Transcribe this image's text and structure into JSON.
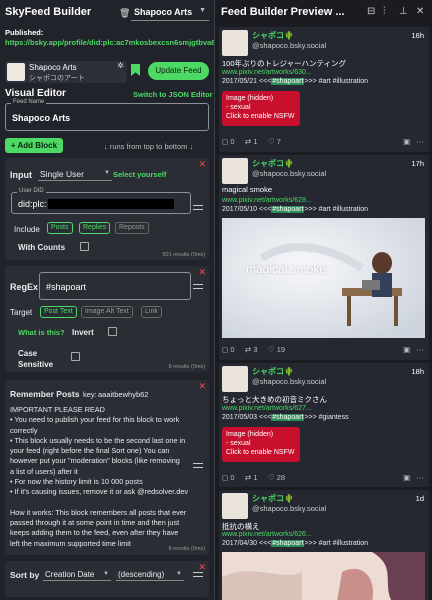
{
  "app": {
    "title": "SkyFeed Builder",
    "feed_select": "Shapoco Arts",
    "published_label": "Published:",
    "published_url": "https://bsky.app/profile/did:plc:ac7mkosbexcsn6smjgtbva6o/feed/aaaitbewhyb62"
  },
  "account": {
    "name": "Shapoco Arts",
    "subtitle": "シャポコのアート"
  },
  "buttons": {
    "update": "Update Feed",
    "switch_json": "Switch to JSON Editor",
    "add_block": "+ Add Block"
  },
  "visual_editor": {
    "title": "Visual Editor",
    "feed_name_label": "Feed Name",
    "feed_name": "Shapoco Arts",
    "runs_note": "↓ runs from top to bottom ↓"
  },
  "input_block": {
    "label": "Input",
    "type": "Single User",
    "select_yourself": "Select yourself",
    "user_did_label": "User DID",
    "user_did": "did:plc:",
    "include_label": "Include",
    "chips": [
      "Posts",
      "Replies",
      "Reposts"
    ],
    "with_counts": "With Counts",
    "results": "501 results (0ms)"
  },
  "regex_block": {
    "label": "RegEx",
    "value": "#shapoart",
    "target_label": "Target",
    "chips": [
      "Post Text",
      "Image Alt Text",
      "Link"
    ],
    "what_is_this": "What is this?",
    "invert": "Invert",
    "case_sensitive": "Case Sensitive",
    "results": "8 results (0ms)"
  },
  "remember_block": {
    "label": "Remember Posts",
    "key_label": "key:",
    "key": "aaaitbewhyb62",
    "lines": [
      "IMPORTANT PLEASE READ",
      "• You need to publish your feed for this block to work",
      "correctly",
      "• This block usually needs to be the second last one in",
      "your feed (right before the final Sort one) You can",
      "however put your \"moderation\" blocks (like removing",
      "a list of users) after it",
      "• For now the history limit is 10 000 posts",
      "• If it's causing issues, remove it or ask @redsolver.dev",
      "",
      "How it works: This block remembers all posts that ever",
      "passed through it at some point in time and then just",
      "keeps adding them to the feed, even after they have",
      "left the maximum supported time limit"
    ],
    "results": "8 results (0ms)"
  },
  "sort_block": {
    "label": "Sort by",
    "field": "Creation Date",
    "order": "(descending)"
  },
  "preview": {
    "title": "Feed Builder Preview ...",
    "posts": [
      {
        "name": "シャポコ🌵",
        "handle": "@shapoco.bsky.social",
        "time": "16h",
        "text": "100年ぶりのトレジャーハンティング",
        "date": "2017/05/21 <<<",
        "tag": "#shapoart",
        "rest": ">>> #art #illustration",
        "url": "www.pixiv.net/artworks/630...",
        "hidden": [
          "Image (hidden)",
          "- sexual",
          "Click to enable NSFW"
        ],
        "replies": "0",
        "reposts": "1",
        "likes": "7"
      },
      {
        "name": "シャポコ🌵",
        "handle": "@shapoco.bsky.social",
        "time": "17h",
        "text": "magical smoke",
        "date": "2017/05/10 <<<",
        "tag": "#shapoart",
        "rest": ">>> #art #illustration",
        "url": "www.pixiv.net/artworks/628...",
        "image_caption": "magical smoke",
        "replies": "0",
        "reposts": "3",
        "likes": "19"
      },
      {
        "name": "シャポコ🌵",
        "handle": "@shapoco.bsky.social",
        "time": "18h",
        "text": "ちょっと大きめの初音ミクさん",
        "date": "2017/05/03 <<<",
        "tag": "#shapoart",
        "rest": ">>> #giantess",
        "url": "www.pixiv.net/artworks/627...",
        "hidden": [
          "Image (hidden)",
          "- sexual",
          "Click to enable NSFW"
        ],
        "replies": "0",
        "reposts": "1",
        "likes": "28"
      },
      {
        "name": "シャポコ🌵",
        "handle": "@shapoco.bsky.social",
        "time": "1d",
        "text": "抵抗の構え",
        "date": "2017/04/30 <<<",
        "tag": "#shapoart",
        "rest": ">>> #art #illustration",
        "url": "www.pixiv.net/artworks/626..."
      }
    ]
  }
}
